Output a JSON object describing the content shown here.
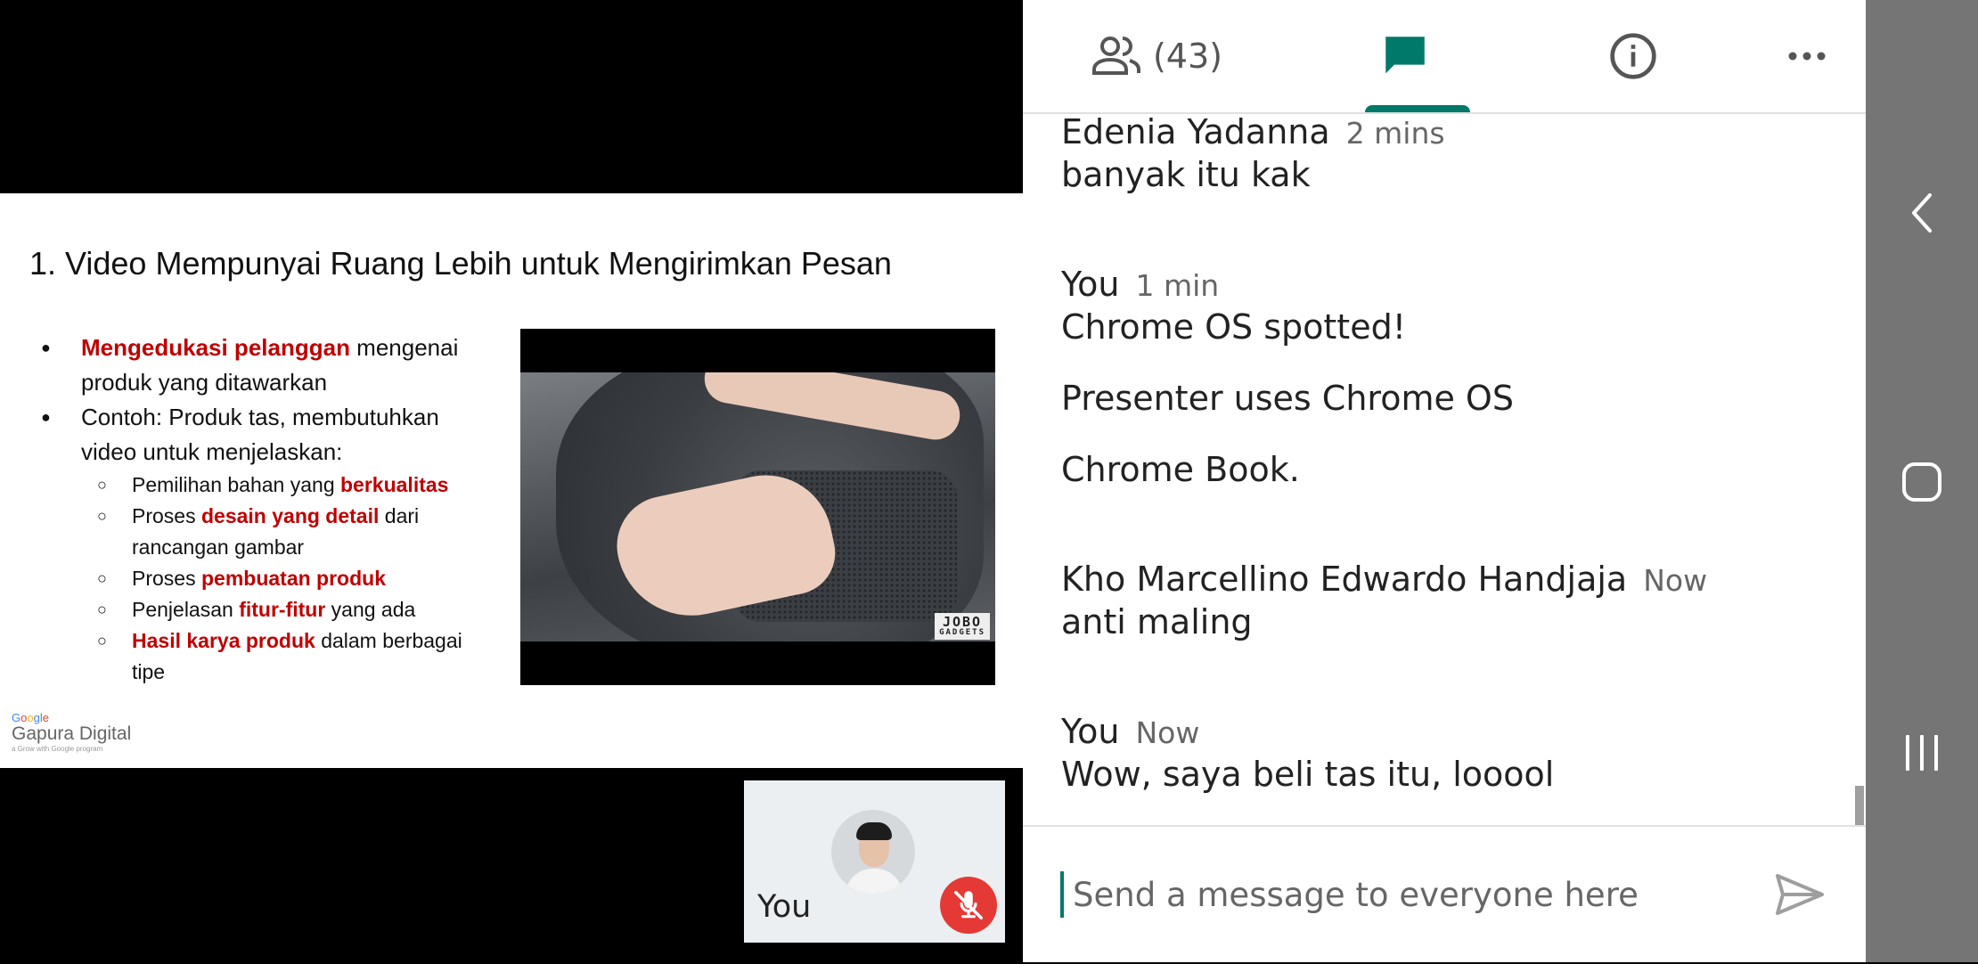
{
  "slide": {
    "title": "1. Video Mempunyai Ruang Lebih untuk Mengirimkan Pesan",
    "bullet1": {
      "highlight": "Mengedukasi pelanggan",
      "text": " mengenai produk yang ditawarkan"
    },
    "bullet2": {
      "text": "Contoh: Produk tas, membutuhkan video untuk menjelaskan:"
    },
    "sub1": {
      "text": "Pemilihan bahan yang ",
      "highlight": "berkualitas"
    },
    "sub2": {
      "pre": "Proses ",
      "highlight": "desain yang detail",
      "post": " dari rancangan gambar"
    },
    "sub3": {
      "pre": "Proses ",
      "highlight": "pembuatan produk"
    },
    "sub4": {
      "pre": "Penjelasan ",
      "highlight": "fitur-fitur",
      "post": " yang ada"
    },
    "sub5": {
      "highlight": "Hasil karya produk",
      "post": " dalam berbagai tipe"
    },
    "video_watermark": "JOBO",
    "video_watermark_sub": "GADGETS",
    "logo": {
      "google": [
        "G",
        "o",
        "o",
        "g",
        "l",
        "e"
      ],
      "name": "Gapura Digital",
      "tagline": "a Grow with Google program"
    }
  },
  "self_tile": {
    "name": "You"
  },
  "tabs": {
    "people_count": "(43)"
  },
  "messages": [
    {
      "name": "Edenia Yadanna",
      "time": "2 mins",
      "texts": [
        "banyak itu kak"
      ]
    },
    {
      "name": "You",
      "time": "1 min",
      "texts": [
        "Chrome OS spotted!",
        "Presenter uses Chrome OS",
        "Chrome Book."
      ]
    },
    {
      "name": "Kho Marcellino Edwardo Handjaja",
      "time": "Now",
      "texts": [
        "anti maling"
      ]
    },
    {
      "name": "You",
      "time": "Now",
      "texts": [
        "Wow, saya beli tas itu, looool"
      ]
    }
  ],
  "composer": {
    "placeholder": "Send a message to everyone here"
  },
  "colors": {
    "accent": "#00796b",
    "highlight": "#c00000",
    "mic_off": "#e53935",
    "navbar": "#757575"
  },
  "icons": [
    "people-icon",
    "chat-icon",
    "info-icon",
    "more-icon",
    "mic-off-icon",
    "send-icon",
    "back-icon",
    "home-icon",
    "recents-icon"
  ]
}
